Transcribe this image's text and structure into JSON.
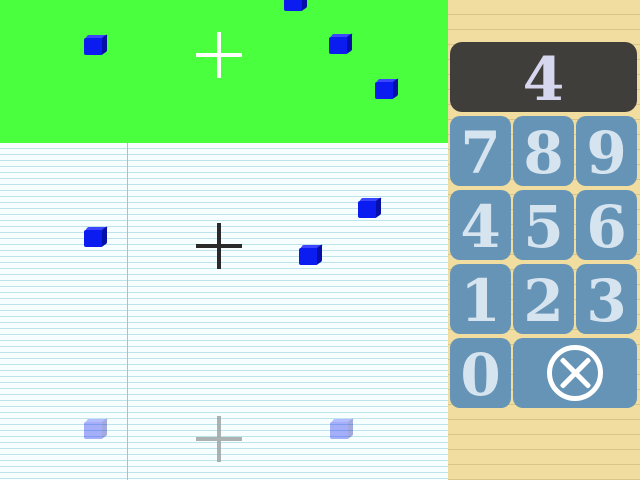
{
  "display": {
    "value": "4"
  },
  "keypad": {
    "keys": [
      "7",
      "8",
      "9",
      "4",
      "5",
      "6",
      "1",
      "2",
      "3",
      "0"
    ],
    "clear_icon": "clear-circle-x-icon"
  },
  "colors": {
    "green_row": "#4aff3d",
    "paper": "#f7feff",
    "cube": "#0b1cf0",
    "key": "#6694b6",
    "display": "#403e3a",
    "panel": "#f1dd9f"
  },
  "board": {
    "rows": [
      {
        "state": "completed",
        "background": "green",
        "crosshair": "white",
        "cubes": 4
      },
      {
        "state": "active",
        "background": "notebook-paper",
        "crosshair": "dark",
        "cubes": 3
      },
      {
        "state": "preview",
        "background": "notebook-paper",
        "crosshair": "faint",
        "cubes": 2
      }
    ]
  }
}
